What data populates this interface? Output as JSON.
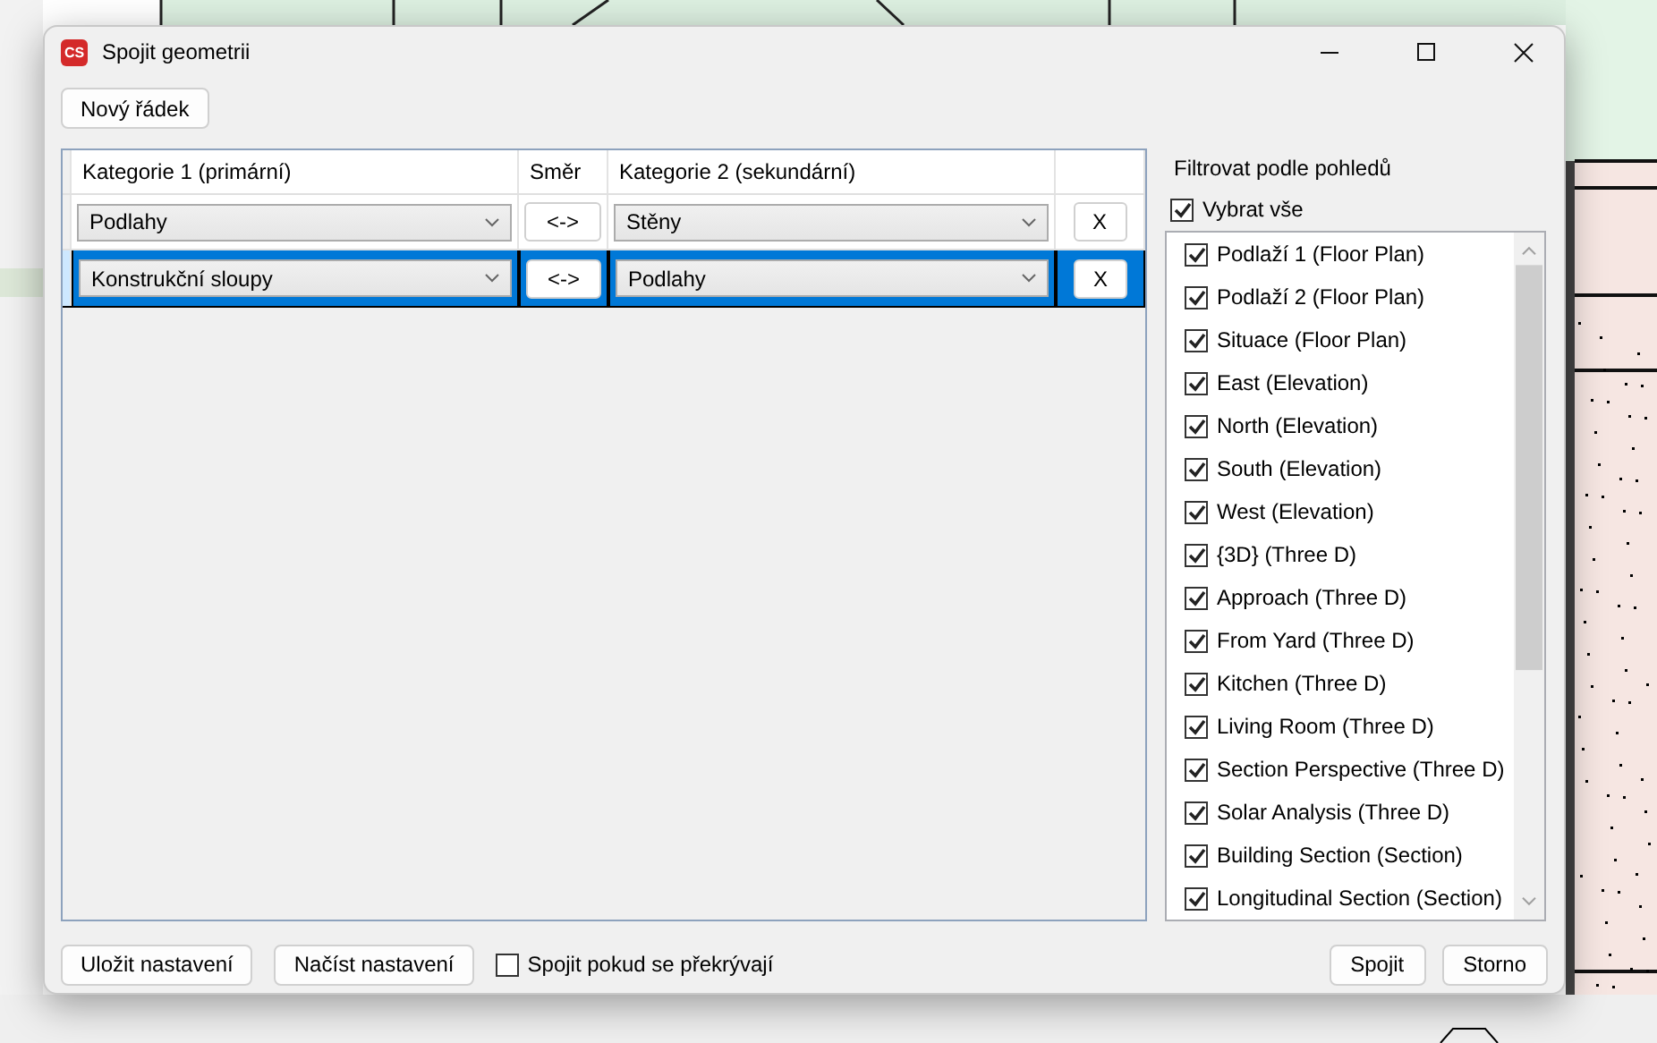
{
  "window": {
    "app_icon": "CS",
    "title": "Spojit geometrii"
  },
  "toolbar": {
    "new_row_button": "Nový řádek"
  },
  "grid": {
    "columns": [
      "Kategorie 1 (primární)",
      "Směr",
      "Kategorie 2 (sekundární)"
    ],
    "rows": [
      {
        "category_1": "Podlahy",
        "direction": "<->",
        "category_2": "Stěny",
        "delete": "X",
        "selected": false
      },
      {
        "category_1": "Konstrukční sloupy",
        "direction": "<->",
        "category_2": "Podlahy",
        "delete": "X",
        "selected": true
      }
    ]
  },
  "view_filter": {
    "title": "Filtrovat podle pohledů",
    "select_all": {
      "label": "Vybrat vše",
      "checked": true
    },
    "views": [
      {
        "label": "Podlaží 1 (Floor Plan)",
        "checked": true
      },
      {
        "label": "Podlaží 2 (Floor Plan)",
        "checked": true
      },
      {
        "label": "Situace (Floor Plan)",
        "checked": true
      },
      {
        "label": "East (Elevation)",
        "checked": true
      },
      {
        "label": "North (Elevation)",
        "checked": true
      },
      {
        "label": "South (Elevation)",
        "checked": true
      },
      {
        "label": "West (Elevation)",
        "checked": true
      },
      {
        "label": "{3D} (Three D)",
        "checked": true
      },
      {
        "label": "Approach (Three D)",
        "checked": true
      },
      {
        "label": "From Yard (Three D)",
        "checked": true
      },
      {
        "label": "Kitchen (Three D)",
        "checked": true
      },
      {
        "label": "Living Room (Three D)",
        "checked": true
      },
      {
        "label": "Section Perspective (Three D)",
        "checked": true
      },
      {
        "label": "Solar Analysis (Three D)",
        "checked": true
      },
      {
        "label": "Building Section (Section)",
        "checked": true
      },
      {
        "label": "Longitudinal Section (Section)",
        "checked": true
      }
    ]
  },
  "footer": {
    "save_button": "Uložit nastavení",
    "load_button": "Načíst nastavení",
    "overlap_option": {
      "label": "Spojit pokud se překrývají",
      "checked": false
    },
    "join_button": "Spojit",
    "cancel_button": "Storno"
  }
}
